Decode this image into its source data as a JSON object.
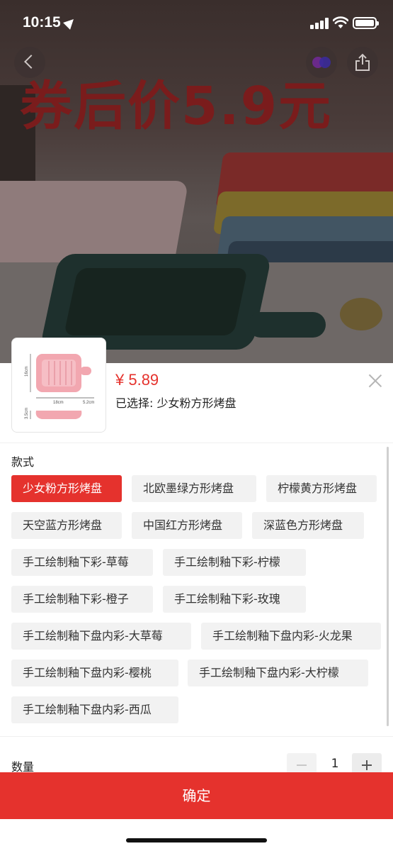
{
  "status_bar": {
    "time": "10:15"
  },
  "banner": {
    "promo_text": "券后价5.9元"
  },
  "product": {
    "price": "¥ 5.89",
    "selected_label": "已选择: 少女粉方形烤盘"
  },
  "style_section": {
    "title": "款式",
    "options": [
      {
        "label": "少女粉方形烤盘",
        "active": true
      },
      {
        "label": "北欧墨绿方形烤盘",
        "active": false
      },
      {
        "label": "柠檬黄方形烤盘",
        "active": false
      },
      {
        "label": "天空蓝方形烤盘",
        "active": false
      },
      {
        "label": "中国红方形烤盘",
        "active": false
      },
      {
        "label": "深蓝色方形烤盘",
        "active": false
      },
      {
        "label": "手工绘制釉下彩-草莓",
        "active": false
      },
      {
        "label": "手工绘制釉下彩-柠檬",
        "active": false
      },
      {
        "label": "手工绘制釉下彩-橙子",
        "active": false
      },
      {
        "label": "手工绘制釉下彩-玫瑰",
        "active": false
      },
      {
        "label": "手工绘制釉下盘内彩-大草莓",
        "active": false
      },
      {
        "label": "手工绘制釉下盘内彩-火龙果",
        "active": false
      },
      {
        "label": "手工绘制釉下盘内彩-樱桃",
        "active": false
      },
      {
        "label": "手工绘制釉下盘内彩-大柠檬",
        "active": false
      },
      {
        "label": "手工绘制釉下盘内彩-西瓜",
        "active": false
      }
    ]
  },
  "quantity": {
    "label": "数量",
    "value": "1"
  },
  "thumbnail": {
    "dim_width": "18cm",
    "dim_handle": "5.2cm",
    "dim_height": "16cm",
    "dim_depth": "3.5cm"
  },
  "confirm_label": "确定",
  "colors": {
    "accent": "#e5322d",
    "chip_bg": "#f2f2f2"
  },
  "icons": [
    "location-arrow-icon",
    "signal-icon",
    "wifi-icon",
    "battery-icon",
    "back-chevron-icon",
    "live-icon",
    "share-icon",
    "close-icon",
    "minus-icon",
    "plus-icon"
  ]
}
